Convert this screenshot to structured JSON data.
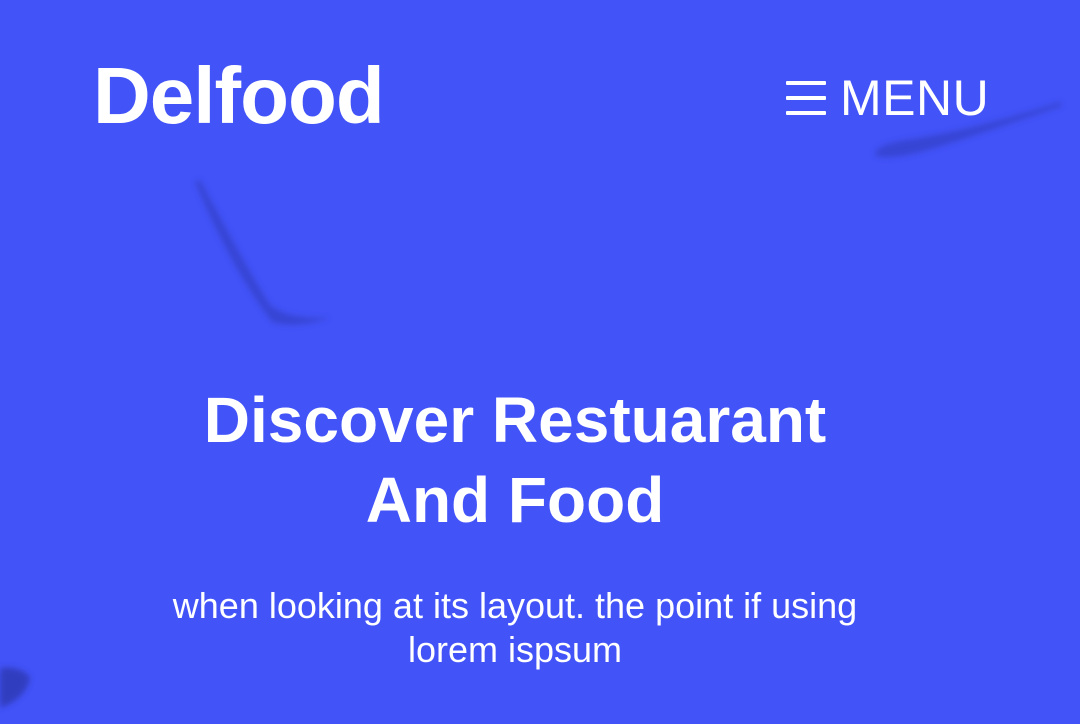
{
  "header": {
    "brand": "Delfood",
    "menu": {
      "icon": "hamburger-icon",
      "label": "MENU"
    }
  },
  "hero": {
    "headline_line1": "Discover Restuarant",
    "headline_line2": "And Food",
    "subtext_line1": "when looking at its layout. the point if using",
    "subtext_line2": "lorem ispsum"
  },
  "colors": {
    "background": "#4253f8",
    "text": "#ffffff"
  }
}
